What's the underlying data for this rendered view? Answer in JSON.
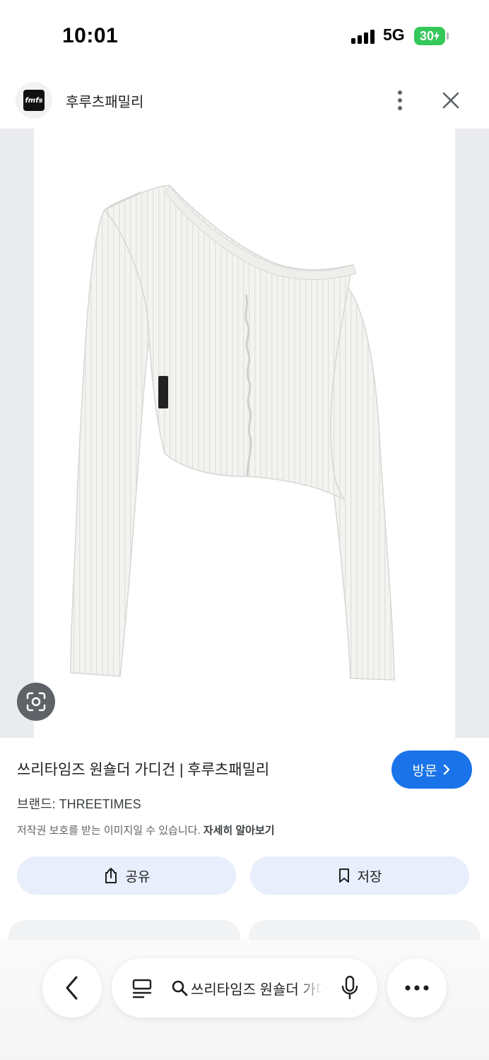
{
  "status_bar": {
    "time": "10:01",
    "network": "5G",
    "battery": "30"
  },
  "site": {
    "name": "후루츠패밀리",
    "logo_text": "fmfs"
  },
  "product": {
    "title": "쓰리타임즈 원숄더 가디건 | 후루츠패밀리",
    "brand": "브랜드: THREETIMES",
    "copyright_note": "저작권 보호를 받는 이미지일 수 있습니다.",
    "learn_more": "자세히 알아보기",
    "visit_label": "방문"
  },
  "actions": {
    "share_label": "공유",
    "save_label": "저장"
  },
  "bottom_bar": {
    "search_query": "쓰리타임즈 원숄더 가디건"
  },
  "colors": {
    "accent": "#1a73e8",
    "action_bg": "#e8eefc",
    "image_bg": "#e9ebee",
    "battery": "#34c759"
  },
  "icons": [
    "signal-icon",
    "battery-icon",
    "more-vert-icon",
    "close-icon",
    "lens-icon",
    "chevron-right-icon",
    "share-icon",
    "bookmark-icon",
    "back-icon",
    "tabs-icon",
    "search-icon",
    "mic-icon",
    "more-horiz-icon"
  ]
}
